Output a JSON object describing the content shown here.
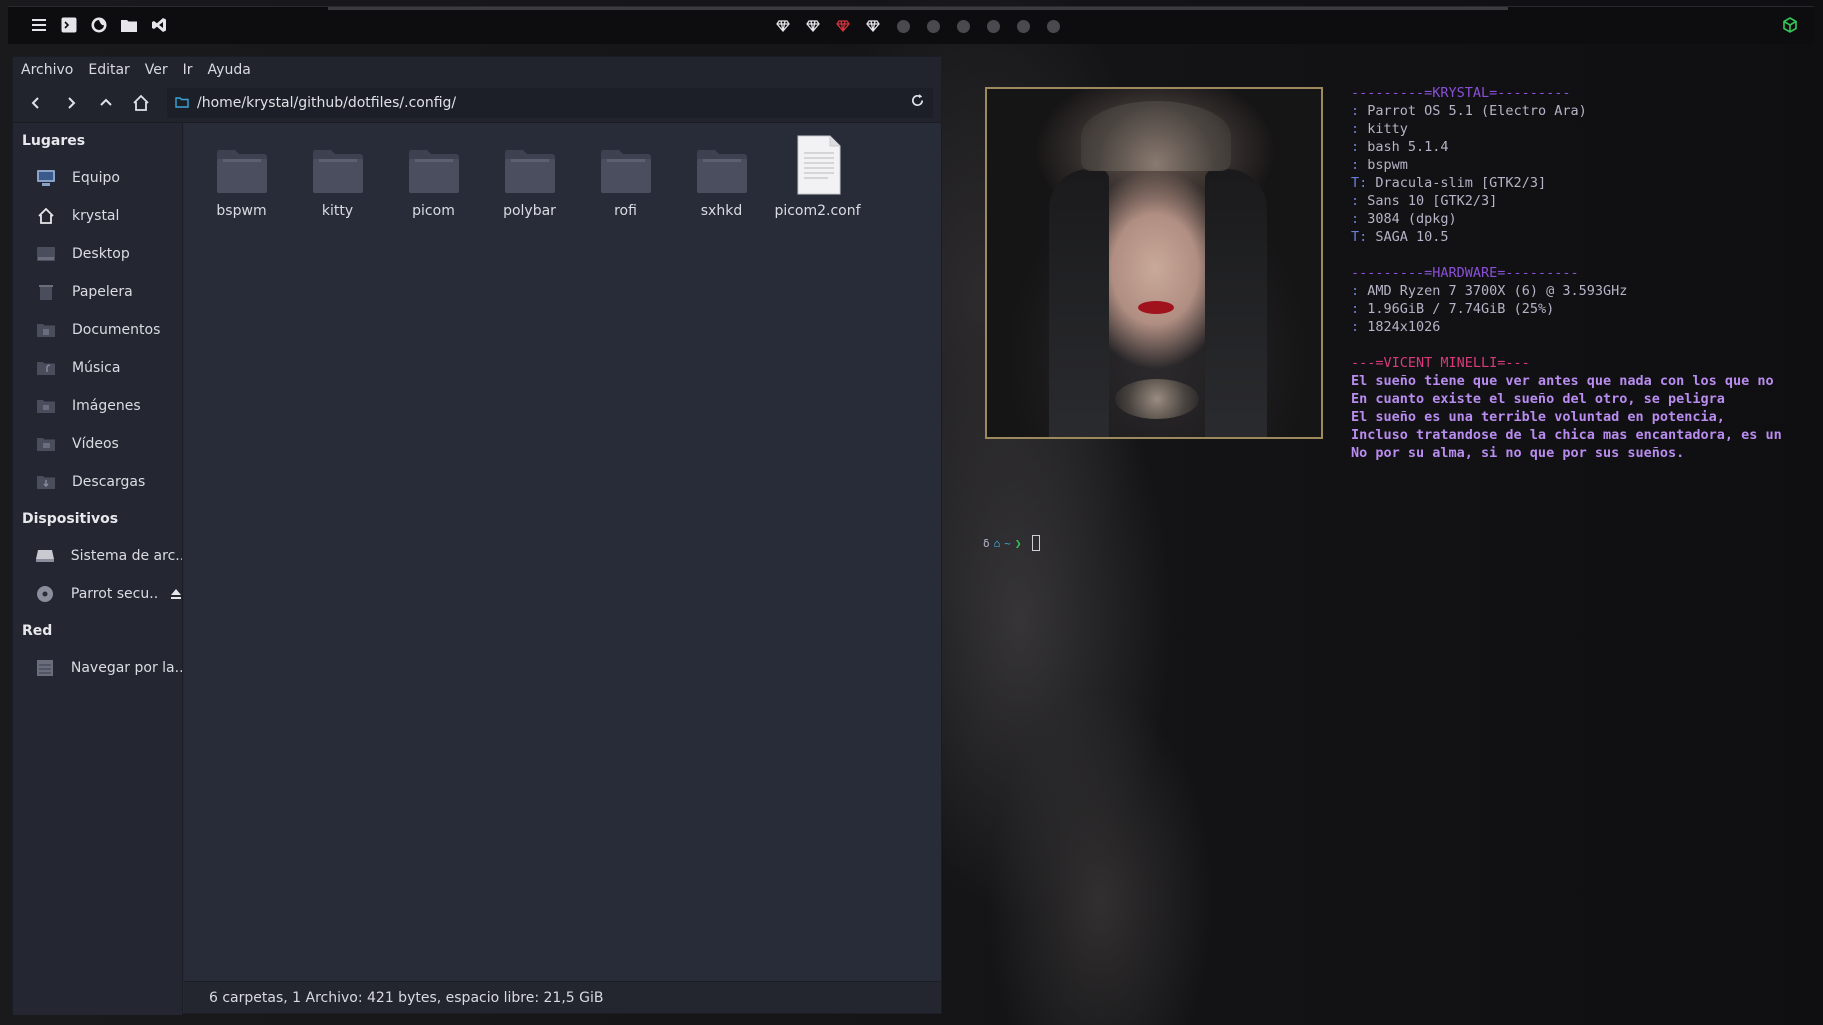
{
  "topbar": {
    "launchers": [
      {
        "name": "menu-icon"
      },
      {
        "name": "terminal-icon"
      },
      {
        "name": "firefox-icon"
      },
      {
        "name": "folder-icon"
      },
      {
        "name": "vscode-icon"
      }
    ],
    "workspaces": [
      {
        "type": "gem",
        "color": "#e6e6ea"
      },
      {
        "type": "gem",
        "color": "#e6e6ea"
      },
      {
        "type": "gem",
        "color": "#d1343c"
      },
      {
        "type": "gem",
        "color": "#e6e6ea"
      },
      {
        "type": "dot"
      },
      {
        "type": "dot"
      },
      {
        "type": "dot"
      },
      {
        "type": "dot"
      },
      {
        "type": "dot"
      },
      {
        "type": "dot"
      }
    ],
    "tray_icon": "cube-icon",
    "tray_color": "#34c759"
  },
  "file_manager": {
    "menu": [
      "Archivo",
      "Editar",
      "Ver",
      "Ir",
      "Ayuda"
    ],
    "path": "/home/krystal/github/dotfiles/.config/",
    "sidebar": {
      "places_header": "Lugares",
      "places": [
        {
          "label": "Equipo",
          "icon": "computer-icon"
        },
        {
          "label": "krystal",
          "icon": "home-icon"
        },
        {
          "label": "Desktop",
          "icon": "desktop-icon"
        },
        {
          "label": "Papelera",
          "icon": "trash-icon"
        },
        {
          "label": "Documentos",
          "icon": "documents-icon"
        },
        {
          "label": "Música",
          "icon": "music-icon"
        },
        {
          "label": "Imágenes",
          "icon": "pictures-icon"
        },
        {
          "label": "Vídeos",
          "icon": "videos-icon"
        },
        {
          "label": "Descargas",
          "icon": "downloads-icon"
        }
      ],
      "devices_header": "Dispositivos",
      "devices": [
        {
          "label": "Sistema de arc...",
          "icon": "drive-icon"
        },
        {
          "label": "Parrot secu...",
          "icon": "disc-icon",
          "eject": true
        }
      ],
      "network_header": "Red",
      "network": [
        {
          "label": "Navegar por la...",
          "icon": "network-icon"
        }
      ]
    },
    "files": [
      {
        "name": "bspwm",
        "type": "folder"
      },
      {
        "name": "kitty",
        "type": "folder"
      },
      {
        "name": "picom",
        "type": "folder"
      },
      {
        "name": "polybar",
        "type": "folder"
      },
      {
        "name": "rofi",
        "type": "folder"
      },
      {
        "name": "sxhkd",
        "type": "folder"
      },
      {
        "name": "picom2.conf",
        "type": "file"
      }
    ],
    "status": "6 carpetas, 1 Archivo: 421 bytes, espacio libre: 21,5  GiB"
  },
  "neofetch": {
    "header_user": "---------=KRYSTAL=---------",
    "info": [
      {
        "key": ": ",
        "value": "Parrot OS 5.1 (Electro Ara)"
      },
      {
        "key": ": ",
        "value": "kitty"
      },
      {
        "key": ": ",
        "value": "bash 5.1.4"
      },
      {
        "key": ": ",
        "value": "bspwm"
      },
      {
        "key": "T: ",
        "value": "Dracula-slim [GTK2/3]"
      },
      {
        "key": ": ",
        "value": "Sans 10 [GTK2/3]"
      },
      {
        "key": ": ",
        "value": "3084 (dpkg)"
      },
      {
        "key": "T: ",
        "value": "SAGA 10.5"
      }
    ],
    "header_hardware": "---------=HARDWARE=---------",
    "hardware": [
      {
        "key": ": ",
        "value": "AMD Ryzen 7 3700X (6) @ 3.593GHz"
      },
      {
        "key": ": ",
        "value": "1.96GiB / 7.74GiB (25%)"
      },
      {
        "key": ": ",
        "value": "1824x1026"
      }
    ],
    "header_quote": "---=VICENT MINELLI=---",
    "quote": [
      "El sueño tiene que ver antes que nada con los que no",
      "En cuanto existe el sueño del otro, se peligra",
      "El sueño es una terrible voluntad en potencia,",
      "Incluso tratandose de la chica mas encantadora, es un",
      "No por su alma, si no que por sus sueños."
    ],
    "prompt_symbols": [
      "δ",
      "⌂",
      "~",
      "❯"
    ]
  }
}
